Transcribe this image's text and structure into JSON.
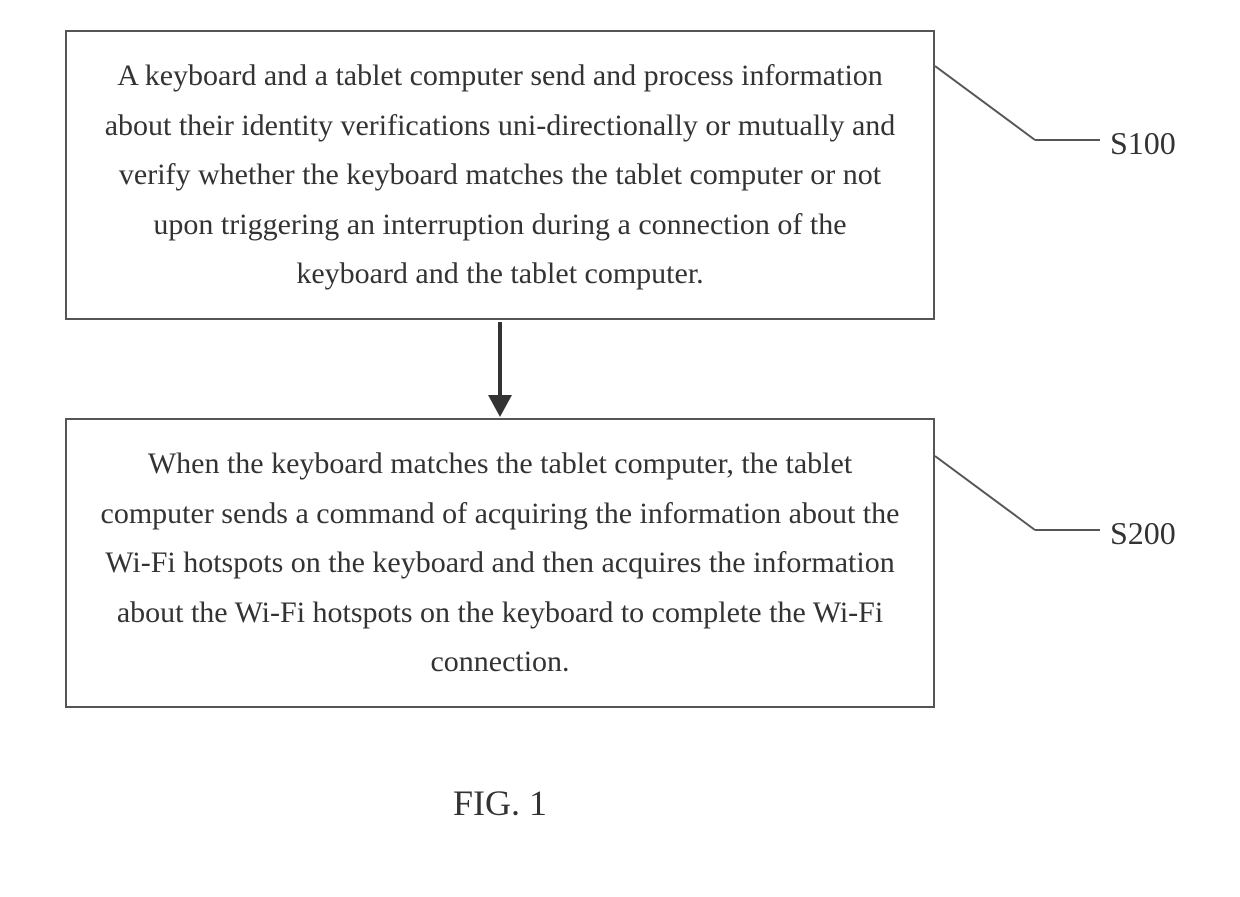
{
  "boxes": {
    "s100": {
      "text": "A keyboard and a tablet computer send and process information about their identity verifications uni-directionally or mutually and verify whether the keyboard matches the tablet computer or not upon triggering an interruption during a connection of the keyboard and the tablet computer.",
      "label": "S100"
    },
    "s200": {
      "text": "When the keyboard matches the tablet computer, the tablet computer sends a command of acquiring the information about the Wi-Fi hotspots on the keyboard and then acquires the information about the Wi-Fi hotspots on the keyboard to complete the Wi-Fi connection.",
      "label": "S200"
    }
  },
  "figure_label": "FIG. 1"
}
